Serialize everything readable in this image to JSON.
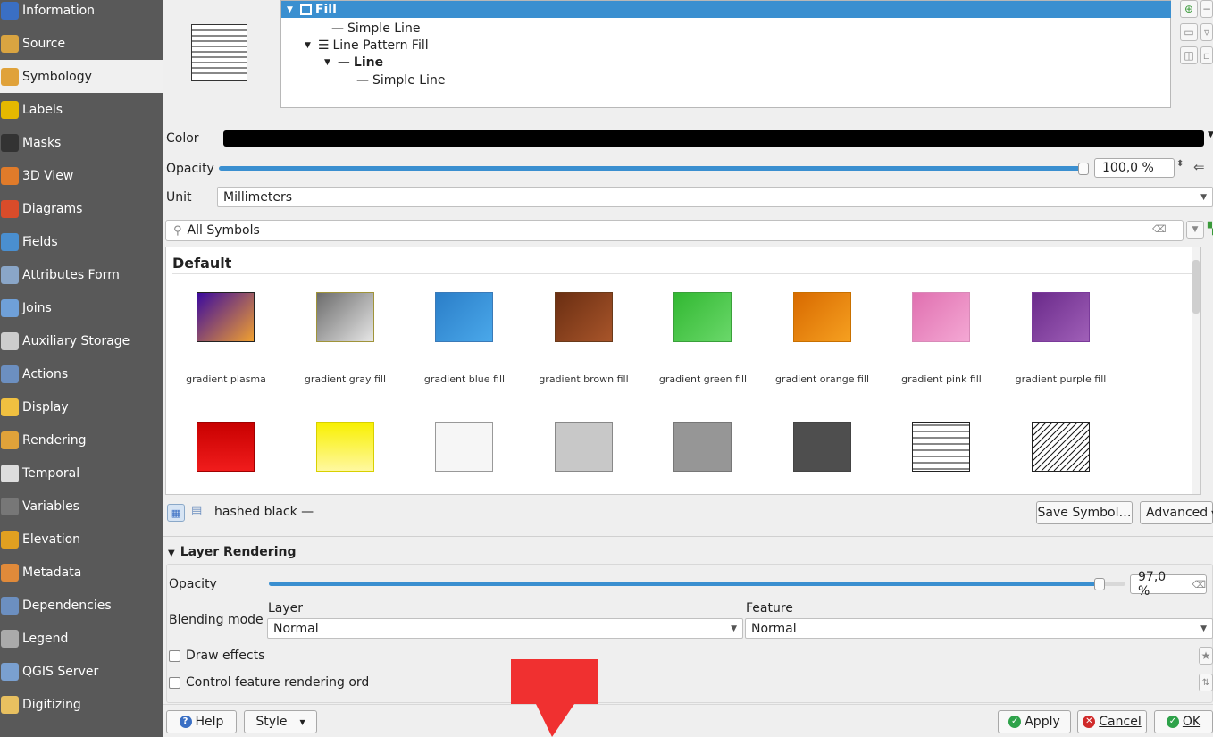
{
  "sidebar": {
    "items": [
      {
        "label": "Information",
        "icon": "info-icon",
        "color": "#3a6fc4"
      },
      {
        "label": "Source",
        "icon": "source-icon",
        "color": "#d9a441"
      },
      {
        "label": "Symbology",
        "icon": "paintbrush-icon",
        "color": "#e0a23a",
        "active": true
      },
      {
        "label": "Labels",
        "icon": "labels-icon",
        "color": "#e6b800"
      },
      {
        "label": "Masks",
        "icon": "masks-icon",
        "color": "#333333"
      },
      {
        "label": "3D View",
        "icon": "cube-icon",
        "color": "#e07b2a"
      },
      {
        "label": "Diagrams",
        "icon": "diagram-icon",
        "color": "#d94c2a"
      },
      {
        "label": "Fields",
        "icon": "fields-icon",
        "color": "#4a8fd0"
      },
      {
        "label": "Attributes Form",
        "icon": "form-icon",
        "color": "#8aa6c8"
      },
      {
        "label": "Joins",
        "icon": "joins-icon",
        "color": "#6fa0d8"
      },
      {
        "label": "Auxiliary Storage",
        "icon": "storage-icon",
        "color": "#cccccc"
      },
      {
        "label": "Actions",
        "icon": "gear-icon",
        "color": "#6c8fc0"
      },
      {
        "label": "Display",
        "icon": "display-icon",
        "color": "#f0c040"
      },
      {
        "label": "Rendering",
        "icon": "rendering-icon",
        "color": "#e0a23a"
      },
      {
        "label": "Temporal",
        "icon": "clock-icon",
        "color": "#dddddd"
      },
      {
        "label": "Variables",
        "icon": "variables-icon",
        "color": "#777777"
      },
      {
        "label": "Elevation",
        "icon": "elevation-icon",
        "color": "#e0a020"
      },
      {
        "label": "Metadata",
        "icon": "metadata-icon",
        "color": "#e08a3a"
      },
      {
        "label": "Dependencies",
        "icon": "dependencies-icon",
        "color": "#6c8fc0"
      },
      {
        "label": "Legend",
        "icon": "legend-icon",
        "color": "#aaaaaa"
      },
      {
        "label": "QGIS Server",
        "icon": "server-icon",
        "color": "#7aa0d0"
      },
      {
        "label": "Digitizing",
        "icon": "digitizing-icon",
        "color": "#e8c060"
      }
    ]
  },
  "symbol_tree": {
    "fill": "Fill",
    "simple_line_1": "Simple Line",
    "line_pattern_fill": "Line Pattern Fill",
    "line": "Line",
    "simple_line_2": "Simple Line"
  },
  "props": {
    "color_label": "Color",
    "color_value": "#000000",
    "opacity_label": "Opacity",
    "opacity_value": "100,0 %",
    "opacity_level": 1.0,
    "unit_label": "Unit",
    "unit_value": "Millimeters"
  },
  "search": {
    "text": "All Symbols"
  },
  "gallery": {
    "group": "Default",
    "row1": [
      {
        "label": "gradient  plasma",
        "from": "#3b0a9e",
        "to": "#f0a030",
        "border": "#222222"
      },
      {
        "label": "gradient  gray fill",
        "from": "#6c6c6c",
        "to": "#e6e6e6",
        "border": "#a0943a"
      },
      {
        "label": "gradient blue fill",
        "from": "#2b7ec8",
        "to": "#4aa8ea",
        "border": "#3a7ab8"
      },
      {
        "label": "gradient brown fill",
        "from": "#6a2e12",
        "to": "#a8552a",
        "border": "#6a3a1a"
      },
      {
        "label": "gradient green fill",
        "from": "#32b832",
        "to": "#6ad86a",
        "border": "#3aa03a"
      },
      {
        "label": "gradient orange fill",
        "from": "#d86a00",
        "to": "#f6a020",
        "border": "#c87000"
      },
      {
        "label": "gradient pink fill",
        "from": "#e070b0",
        "to": "#f4a8d4",
        "border": "#d88ab8"
      },
      {
        "label": "gradient purple fill",
        "from": "#6a2a8a",
        "to": "#a060b8",
        "border": "#7a3a9a"
      }
    ],
    "row2": [
      {
        "from": "#c80000",
        "to": "#f01c1c",
        "border": "#a00000"
      },
      {
        "from": "#f8f000",
        "to": "#fff8a0",
        "border": "#d8d000"
      },
      {
        "from": "#f6f6f6",
        "to": "#f6f6f6",
        "border": "#999999"
      },
      {
        "from": "#c8c8c8",
        "to": "#c8c8c8",
        "border": "#888888"
      },
      {
        "from": "#969696",
        "to": "#969696",
        "border": "#777777"
      },
      {
        "from": "#4e4e4e",
        "to": "#4e4e4e",
        "border": "#444444"
      },
      {
        "pattern": "horizontal"
      },
      {
        "pattern": "diagonal"
      }
    ]
  },
  "symbol_bar": {
    "current": "hashed black —",
    "save_button": "Save Symbol…",
    "advanced_button": "Advanced"
  },
  "layer_rendering": {
    "title": "Layer Rendering",
    "opacity_label": "Opacity",
    "opacity_value": "97,0 %",
    "opacity_level": 0.97,
    "blending_label": "Blending mode",
    "layer_label": "Layer",
    "layer_value": "Normal",
    "feature_label": "Feature",
    "feature_value": "Normal",
    "draw_effects": "Draw effects",
    "control_order": "Control feature rendering ord"
  },
  "footer": {
    "help": "Help",
    "style": "Style",
    "apply": "Apply",
    "cancel": "Cancel",
    "ok": "OK"
  },
  "colors": {
    "accent": "#3a8fd0",
    "sidebar": "#595959",
    "arrow": "#f03030"
  }
}
